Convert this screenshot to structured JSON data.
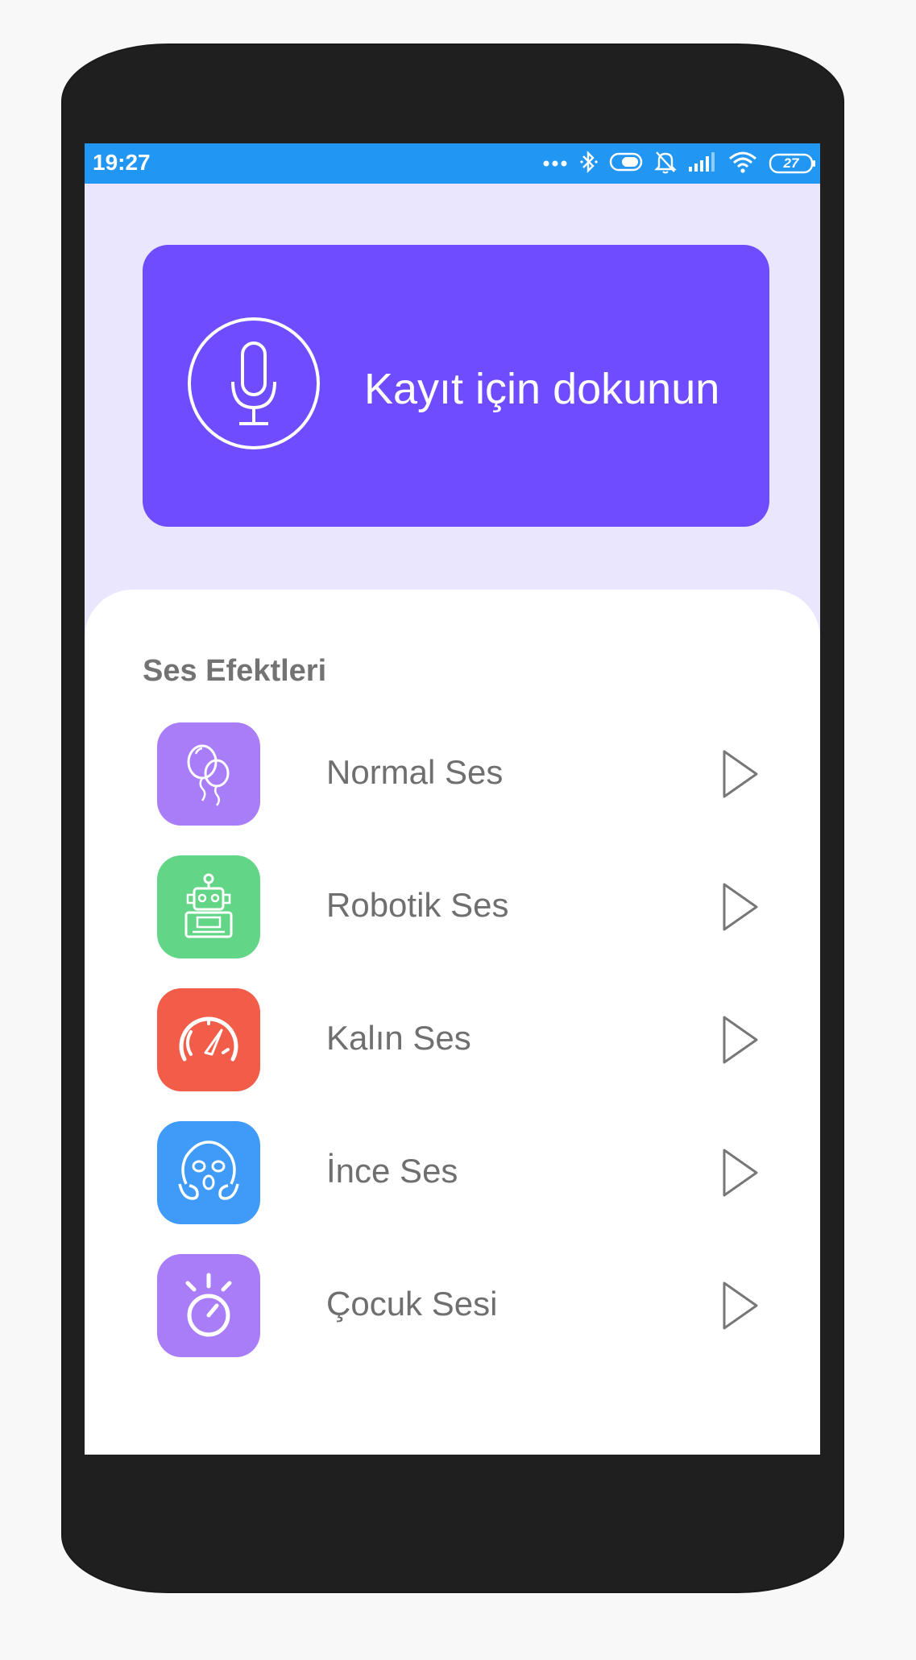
{
  "status_bar": {
    "time": "19:27",
    "battery": "27",
    "icons": [
      "more-dots-icon",
      "bluetooth-icon",
      "toggle-icon",
      "mute-bell-icon",
      "signal-icon",
      "wifi-icon",
      "battery-icon"
    ]
  },
  "record": {
    "label": "Kayıt için dokunun",
    "icon": "microphone-icon"
  },
  "effects": {
    "title": "Ses Efektleri",
    "items": [
      {
        "label": "Normal Ses",
        "icon": "balloons-icon",
        "color": "#a97cf8"
      },
      {
        "label": "Robotik Ses",
        "icon": "robot-icon",
        "color": "#63d587"
      },
      {
        "label": "Kalın Ses",
        "icon": "speedometer-icon",
        "color": "#f25d4a"
      },
      {
        "label": "İnce Ses",
        "icon": "scared-face-icon",
        "color": "#3f9bf7"
      },
      {
        "label": "Çocuk Sesi",
        "icon": "stopwatch-icon",
        "color": "#a97cf8"
      }
    ]
  },
  "colors": {
    "status_bar": "#2196f3",
    "record_card": "#6f4cff",
    "screen_bg": "#e9e6fd",
    "phone_body": "#1f1f1f"
  }
}
